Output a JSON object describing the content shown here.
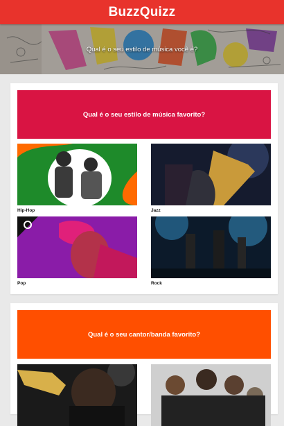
{
  "app": {
    "title": "BuzzQuizz"
  },
  "hero": {
    "text": "Qual é o seu estilo de música você é?"
  },
  "quizzes": [
    {
      "question": "Qual é o seu estilo de música favorito?",
      "color": "#d91443",
      "options": [
        {
          "label": "Hip-Hop",
          "image": "hip-hop-duo-photo"
        },
        {
          "label": "Jazz",
          "image": "saxophone-player-photo"
        },
        {
          "label": "Pop",
          "image": "pop-singer-photo"
        },
        {
          "label": "Rock",
          "image": "rock-band-stage-photo"
        }
      ]
    },
    {
      "question": "Qual é o seu cantor/banda favorito?",
      "color": "#ff4f00",
      "options": [
        {
          "label": "",
          "image": "trumpet-player-photo"
        },
        {
          "label": "",
          "image": "rock-band-group-photo"
        }
      ]
    }
  ],
  "colors": {
    "topbar": "#e8332c",
    "background": "#e9e9e9"
  }
}
